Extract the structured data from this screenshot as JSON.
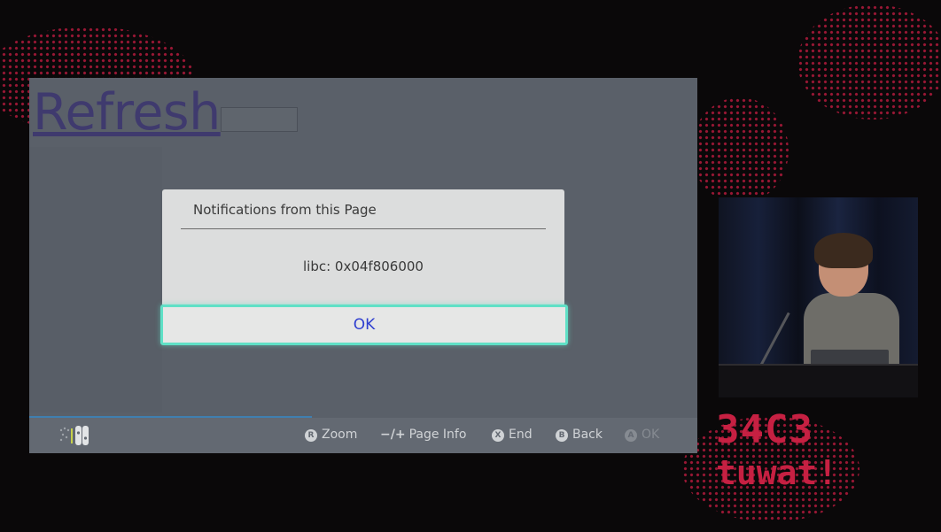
{
  "browser": {
    "link_text": "Refresh"
  },
  "dialog": {
    "title": "Notifications from this Page",
    "message": "libc: 0x04f806000",
    "ok_label": "OK"
  },
  "controls": [
    {
      "glyph": "R",
      "label": "Zoom",
      "enabled": true
    },
    {
      "glyph": "−/+",
      "label": "Page Info",
      "enabled": true
    },
    {
      "glyph": "X",
      "label": "End",
      "enabled": true
    },
    {
      "glyph": "B",
      "label": "Back",
      "enabled": true
    },
    {
      "glyph": "A",
      "label": "OK",
      "enabled": false
    }
  ],
  "event_logo": {
    "line1": "34C3",
    "line2": "tuwat!"
  },
  "colors": {
    "accent_focus": "#5fe0c6",
    "ok_text": "#2f3fd0",
    "logo_red": "#c62042"
  }
}
